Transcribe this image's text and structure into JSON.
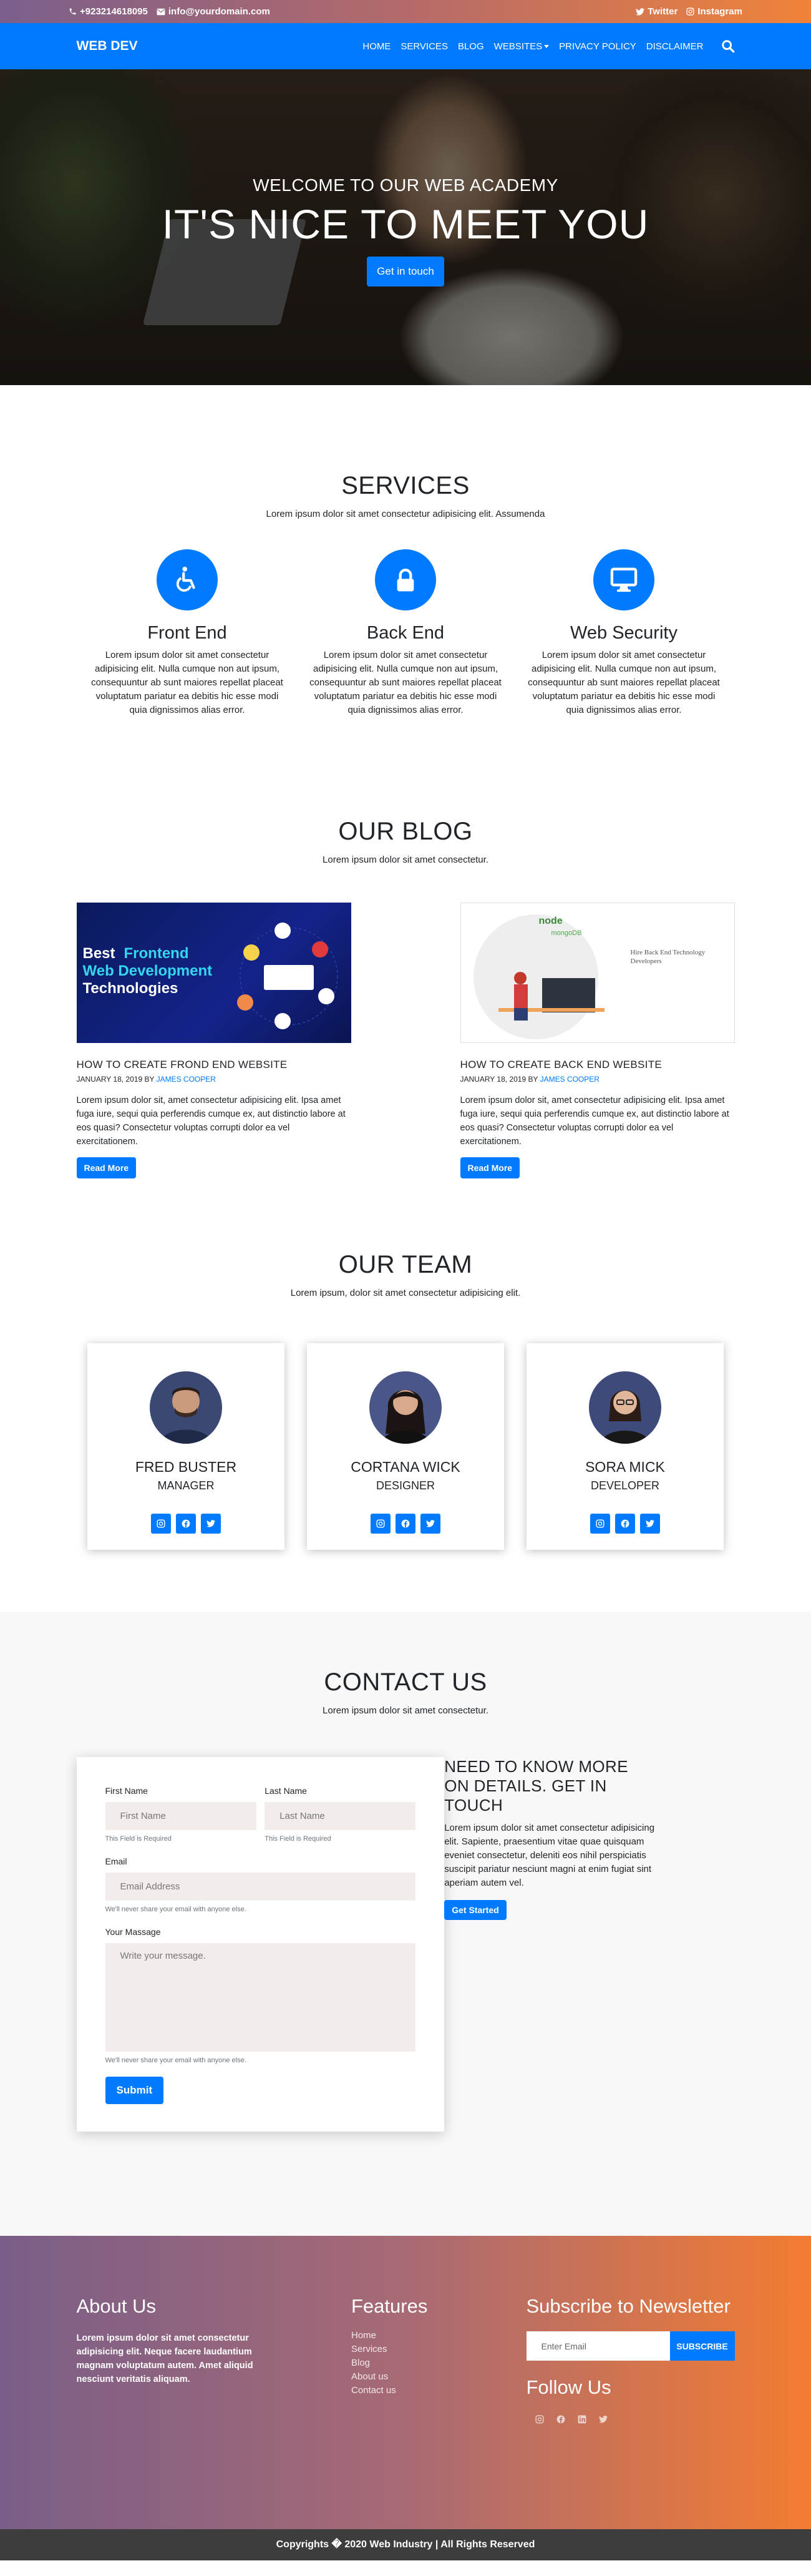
{
  "topbar": {
    "phone": "+923214618095",
    "email": "info@yourdomain.com",
    "twitter": "Twitter",
    "instagram": "Instagram"
  },
  "nav": {
    "brand": "WEB DEV",
    "items": [
      "HOME",
      "SERVICES",
      "BLOG",
      "WEBSITES",
      "PRIVACY POLICY",
      "DISCLAIMER"
    ]
  },
  "hero": {
    "subtitle": "WELCOME TO OUR WEB ACADEMY",
    "title": "IT'S NICE TO MEET YOU",
    "button": "Get in touch"
  },
  "services": {
    "title": "SERVICES",
    "subtitle": "Lorem ipsum dolor sit amet consectetur adipisicing elit. Assumenda",
    "items": [
      {
        "icon": "wheelchair-icon",
        "title": "Front End",
        "text": "Lorem ipsum dolor sit amet consectetur adipisicing elit. Nulla cumque non aut ipsum, consequuntur ab sunt maiores repellat placeat voluptatum pariatur ea debitis hic esse modi quia dignissimos alias error."
      },
      {
        "icon": "lock-icon",
        "title": "Back End",
        "text": "Lorem ipsum dolor sit amet consectetur adipisicing elit. Nulla cumque non aut ipsum, consequuntur ab sunt maiores repellat placeat voluptatum pariatur ea debitis hic esse modi quia dignissimos alias error."
      },
      {
        "icon": "desktop-icon",
        "title": "Web Security",
        "text": "Lorem ipsum dolor sit amet consectetur adipisicing elit. Nulla cumque non aut ipsum, consequuntur ab sunt maiores repellat placeat voluptatum pariatur ea debitis hic esse modi quia dignissimos alias error."
      }
    ]
  },
  "blog": {
    "title": "OUR BLOG",
    "subtitle": "Lorem ipsum dolor sit amet consectetur.",
    "posts": [
      {
        "image_text": [
          "Best",
          "Frontend",
          "Web Development",
          "Technologies"
        ],
        "title": "HOW TO CREATE FROND END WEBSITE",
        "date": "JANUARY 18, 2019 BY",
        "author": "JAMES COOPER",
        "text": "Lorem ipsum dolor sit, amet consectetur adipisicing elit. Ipsa amet fuga iure, sequi quia perferendis cumque ex, aut distinctio labore at eos quasi? Consectetur voluptas corrupti dolor ea vel exercitationem.",
        "button": "Read More"
      },
      {
        "image_text": [
          "node",
          "mongoDB",
          "Hire Back End Technology",
          "Developers"
        ],
        "title": "HOW TO CREATE BACK END WEBSITE",
        "date": "JANUARY 18, 2019 BY",
        "author": "JAMES COOPER",
        "text": "Lorem ipsum dolor sit, amet consectetur adipisicing elit. Ipsa amet fuga iure, sequi quia perferendis cumque ex, aut distinctio labore at eos quasi? Consectetur voluptas corrupti dolor ea vel exercitationem.",
        "button": "Read More"
      }
    ]
  },
  "team": {
    "title": "OUR TEAM",
    "subtitle": "Lorem ipsum, dolor sit amet consectetur adipisicing elit.",
    "members": [
      {
        "name": "FRED BUSTER",
        "role": "MANAGER"
      },
      {
        "name": "CORTANA WICK",
        "role": "DESIGNER"
      },
      {
        "name": "SORA MICK",
        "role": "DEVELOPER"
      }
    ]
  },
  "contact": {
    "title": "CONTACT US",
    "subtitle": "Lorem ipsum dolor sit amet consectetur.",
    "form": {
      "first_label": "First Name",
      "first_placeholder": "First Name",
      "first_help": "This Field is Required",
      "last_label": "Last Name",
      "last_placeholder": "Last Name",
      "last_help": "This Field is Required",
      "email_label": "Email",
      "email_placeholder": "Email Address",
      "email_help": "We'll never share your email with anyone else.",
      "message_label": "Your Massage",
      "message_placeholder": "Write your message.",
      "message_help": "We'll never share your email with anyone else.",
      "submit": "Submit"
    },
    "info": {
      "heading": "NEED TO KNOW MORE ON DETAILS. GET IN TOUCH",
      "text": "Lorem ipsum dolor sit amet consectetur adipisicing elit. Sapiente, praesentium vitae quae quisquam eveniet consectetur, deleniti eos nihil perspiciatis suscipit pariatur nesciunt magni at enim fugiat sint aperiam autem vel.",
      "button": "Get Started"
    }
  },
  "footer": {
    "about_title": "About Us",
    "about_text": "Lorem ipsum dolor sit amet consectetur adipisicing elit. Neque facere laudantium magnam voluptatum autem. Amet aliquid nesciunt veritatis aliquam.",
    "features_title": "Features",
    "features": [
      "Home",
      "Services",
      "Blog",
      "About us",
      "Contact us"
    ],
    "newsletter_title": "Subscribe to Newsletter",
    "newsletter_placeholder": "Enter Email",
    "newsletter_button": "SUBSCRIBE",
    "follow_title": "Follow Us",
    "copyright": "Copyrights � 2020 Web Industry | All Rights Reserved"
  },
  "colors": {
    "accent": "#007bff",
    "gradient_start": "#7a5e88",
    "gradient_end": "#f37c31",
    "copyright_bg": "#3d3d3d"
  }
}
